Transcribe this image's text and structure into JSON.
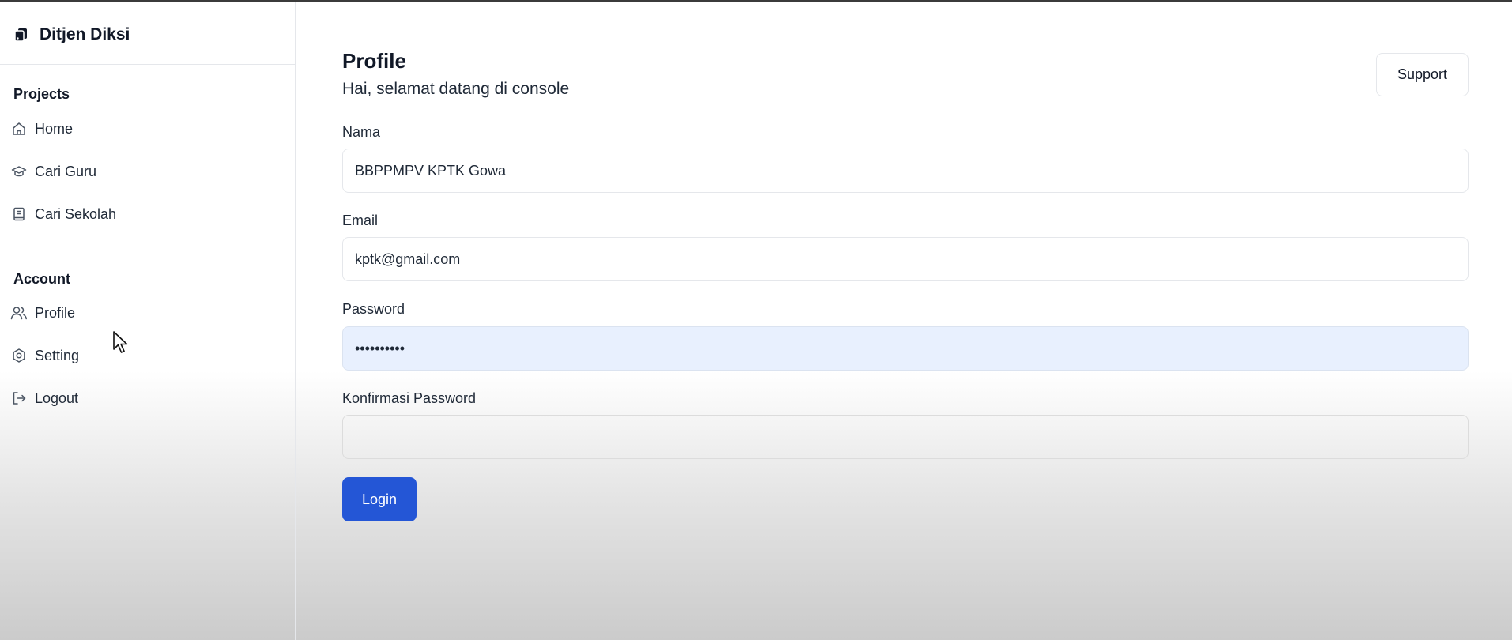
{
  "app": {
    "brand_name": "Ditjen Diksi"
  },
  "sidebar": {
    "sections": [
      {
        "label": "Projects",
        "items": [
          {
            "label": "Home",
            "icon": "home-icon"
          },
          {
            "label": "Cari Guru",
            "icon": "graduation-cap-icon"
          },
          {
            "label": "Cari Sekolah",
            "icon": "book-icon"
          }
        ]
      },
      {
        "label": "Account",
        "items": [
          {
            "label": "Profile",
            "icon": "users-icon"
          },
          {
            "label": "Setting",
            "icon": "gear-icon"
          },
          {
            "label": "Logout",
            "icon": "logout-icon"
          }
        ]
      }
    ]
  },
  "header": {
    "title": "Profile",
    "subtitle": "Hai, selamat datang di console",
    "support_label": "Support"
  },
  "form": {
    "nama": {
      "label": "Nama",
      "value": "BBPPMPV KPTK Gowa"
    },
    "email": {
      "label": "Email",
      "value": "kptk@gmail.com"
    },
    "password": {
      "label": "Password",
      "value": "••••••••••"
    },
    "confirm_password": {
      "label": "Konfirmasi Password",
      "value": ""
    },
    "submit_label": "Login"
  },
  "colors": {
    "primary_button": "#2456d6",
    "autofill_background": "#e8f0fe",
    "border": "#e5e7eb"
  }
}
